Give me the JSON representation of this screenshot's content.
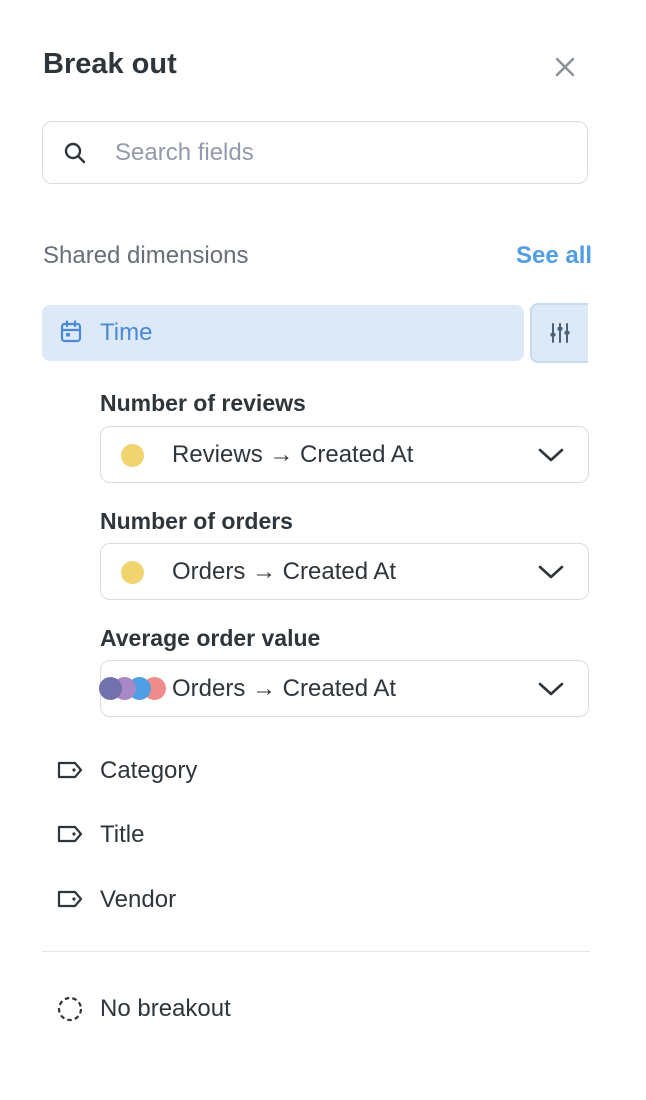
{
  "panel": {
    "title": "Break out"
  },
  "search": {
    "placeholder": "Search fields",
    "value": ""
  },
  "shared": {
    "label": "Shared dimensions",
    "see_all": "See all"
  },
  "time": {
    "label": "Time"
  },
  "groups": [
    {
      "title": "Number of reviews",
      "value": "Reviews → Created At",
      "dot_colors": [
        "#f0d46f"
      ]
    },
    {
      "title": "Number of orders",
      "value": "Orders → Created At",
      "dot_colors": [
        "#f0d46f"
      ]
    },
    {
      "title": "Average order value",
      "value": "Orders → Created At",
      "dot_colors": [
        "#7172ad",
        "#a989c5",
        "#509ee3",
        "#ef8c8c"
      ]
    }
  ],
  "fields": [
    {
      "label": "Category",
      "icon": "tag-icon"
    },
    {
      "label": "Title",
      "icon": "tag-icon"
    },
    {
      "label": "Vendor",
      "icon": "tag-icon"
    }
  ],
  "no_breakout": {
    "label": "No breakout",
    "icon": "dashed-circle-icon"
  },
  "colors": {
    "accent": "#509ee3",
    "selected_bg": "#dde9f7",
    "text": "#2e353b",
    "muted": "#696e7b"
  }
}
